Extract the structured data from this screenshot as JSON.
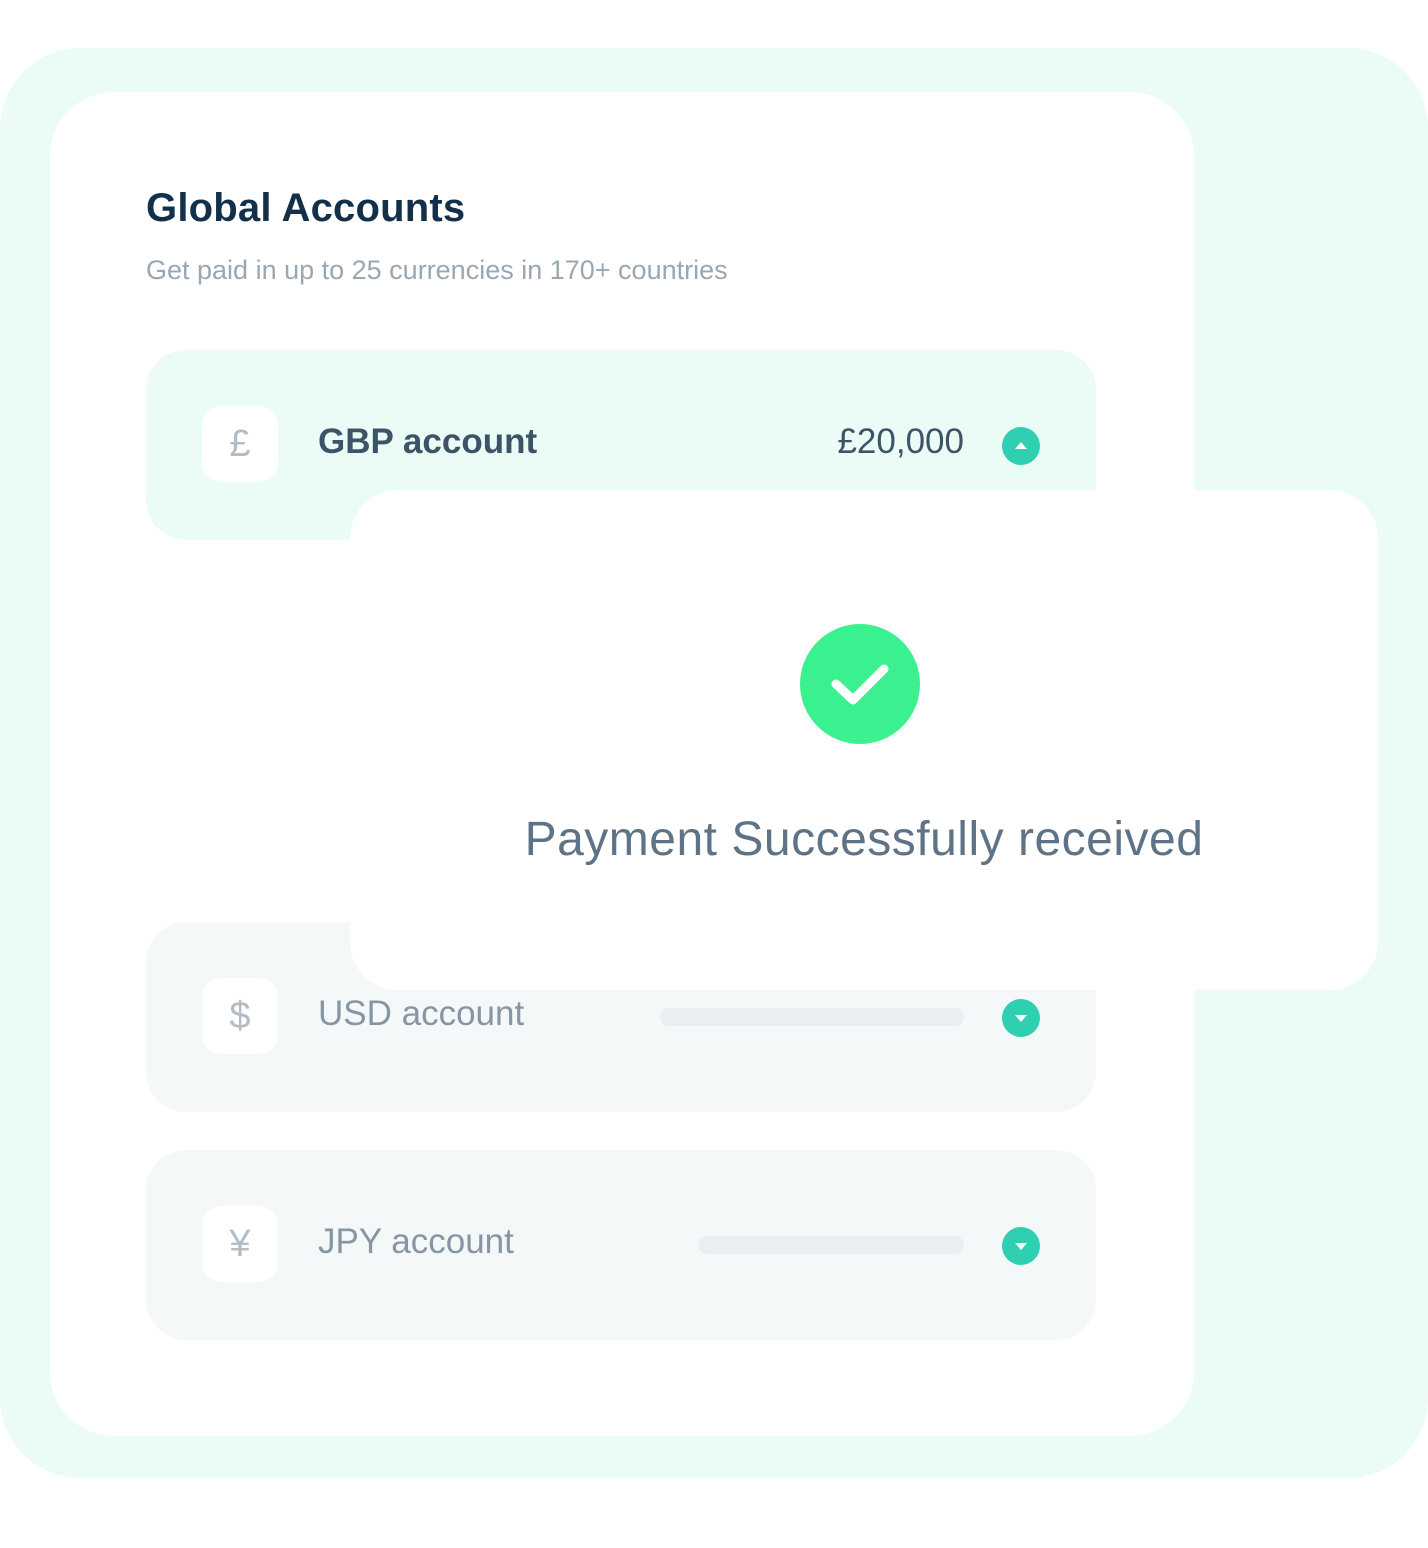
{
  "header": {
    "title": "Global Accounts",
    "subtitle": "Get paid in up to 25 currencies in 170+ countries"
  },
  "accounts": [
    {
      "symbol": "£",
      "label": "GBP account",
      "amount": "£20,000",
      "expanded": true
    },
    {
      "symbol": "$",
      "label": "USD account",
      "amount": "",
      "expanded": false
    },
    {
      "symbol": "¥",
      "label": "JPY account",
      "amount": "",
      "expanded": false
    }
  ],
  "modal": {
    "message": "Payment Successfully received",
    "icon": "check-circle-icon"
  },
  "colors": {
    "accent": "#2fcfb1",
    "success": "#3bf08f",
    "backdrop": "#ebfcf4",
    "title": "#13304a"
  }
}
